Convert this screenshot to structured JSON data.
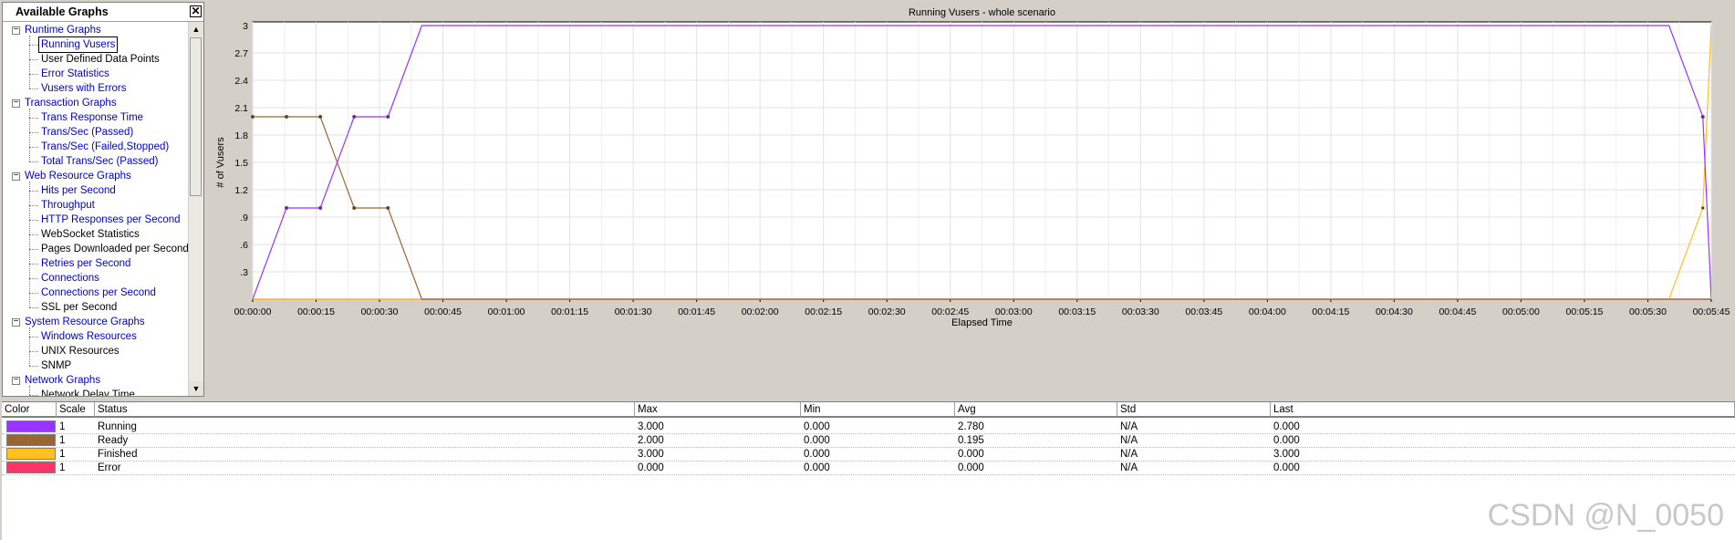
{
  "tree": {
    "title": "Available Graphs",
    "close_glyph": "✕",
    "items": [
      {
        "label": "Runtime Graphs",
        "type": "group"
      },
      {
        "label": "Running Vusers",
        "type": "leaf",
        "style": "blue",
        "selected": true
      },
      {
        "label": "User Defined Data Points",
        "type": "leaf",
        "style": "black"
      },
      {
        "label": "Error Statistics",
        "type": "leaf",
        "style": "blue"
      },
      {
        "label": "Vusers with Errors",
        "type": "leaf",
        "style": "blue"
      },
      {
        "label": "Transaction Graphs",
        "type": "group"
      },
      {
        "label": "Trans Response Time",
        "type": "leaf",
        "style": "blue"
      },
      {
        "label": "Trans/Sec (Passed)",
        "type": "leaf",
        "style": "blue"
      },
      {
        "label": "Trans/Sec (Failed,Stopped)",
        "type": "leaf",
        "style": "blue"
      },
      {
        "label": "Total Trans/Sec (Passed)",
        "type": "leaf",
        "style": "blue"
      },
      {
        "label": "Web Resource Graphs",
        "type": "group"
      },
      {
        "label": "Hits per Second",
        "type": "leaf",
        "style": "blue"
      },
      {
        "label": "Throughput",
        "type": "leaf",
        "style": "blue"
      },
      {
        "label": "HTTP Responses per Second",
        "type": "leaf",
        "style": "blue"
      },
      {
        "label": "WebSocket Statistics",
        "type": "leaf",
        "style": "black"
      },
      {
        "label": "Pages Downloaded per Second",
        "type": "leaf",
        "style": "black"
      },
      {
        "label": "Retries per Second",
        "type": "leaf",
        "style": "blue"
      },
      {
        "label": "Connections",
        "type": "leaf",
        "style": "blue"
      },
      {
        "label": "Connections per Second",
        "type": "leaf",
        "style": "blue"
      },
      {
        "label": "SSL per Second",
        "type": "leaf",
        "style": "black"
      },
      {
        "label": "System Resource Graphs",
        "type": "group"
      },
      {
        "label": "Windows Resources",
        "type": "leaf",
        "style": "blue"
      },
      {
        "label": "UNIX Resources",
        "type": "leaf",
        "style": "black"
      },
      {
        "label": "SNMP",
        "type": "leaf",
        "style": "black"
      },
      {
        "label": "Network Graphs",
        "type": "group"
      },
      {
        "label": "Network Delay Time",
        "type": "leaf",
        "style": "black"
      }
    ]
  },
  "chart_data": {
    "type": "line",
    "title": "Running Vusers - whole scenario",
    "xlabel": "Elapsed Time",
    "ylabel": "# of Vusers",
    "ylim": [
      0,
      3
    ],
    "yticks": [
      "3",
      "2.7",
      "2.4",
      "2.1",
      "1.8",
      "1.5",
      "1.2",
      ".9",
      ".6",
      ".3"
    ],
    "xticks": [
      "00:00:00",
      "00:00:15",
      "00:00:30",
      "00:00:45",
      "00:01:00",
      "00:01:15",
      "00:01:30",
      "00:01:45",
      "00:02:00",
      "00:02:15",
      "00:02:30",
      "00:02:45",
      "00:03:00",
      "00:03:15",
      "00:03:30",
      "00:03:45",
      "00:04:00",
      "00:04:15",
      "00:04:30",
      "00:04:45",
      "00:05:00",
      "00:05:15",
      "00:05:30",
      "00:05:45"
    ],
    "xlim_seconds": [
      0,
      345
    ],
    "grid": true,
    "series": [
      {
        "name": "Running",
        "color": "#9933ff",
        "points": [
          [
            0,
            0
          ],
          [
            8,
            1
          ],
          [
            16,
            1
          ],
          [
            24,
            2
          ],
          [
            32,
            2
          ],
          [
            40,
            3
          ],
          [
            335,
            3
          ],
          [
            343,
            2
          ],
          [
            345,
            0
          ]
        ]
      },
      {
        "name": "Ready",
        "color": "#996633",
        "points": [
          [
            0,
            2
          ],
          [
            8,
            2
          ],
          [
            16,
            2
          ],
          [
            24,
            1
          ],
          [
            32,
            1
          ],
          [
            40,
            0
          ],
          [
            345,
            0
          ]
        ]
      },
      {
        "name": "Finished",
        "color": "#ffc020",
        "points": [
          [
            0,
            0
          ],
          [
            335,
            0
          ],
          [
            343,
            1
          ],
          [
            345,
            3
          ]
        ]
      },
      {
        "name": "Error",
        "color": "#ff3366",
        "points": [
          [
            0,
            0
          ],
          [
            345,
            0
          ]
        ]
      }
    ]
  },
  "legend": {
    "headers": [
      "Color",
      "Scale",
      "Status",
      "Max",
      "Min",
      "Avg",
      "Std",
      "Last"
    ],
    "rows": [
      {
        "color": "#9933ff",
        "scale": "1",
        "status": "Running",
        "max": "3.000",
        "min": "0.000",
        "avg": "2.780",
        "std": "N/A",
        "last": "0.000"
      },
      {
        "color": "#996633",
        "scale": "1",
        "status": "Ready",
        "max": "2.000",
        "min": "0.000",
        "avg": "0.195",
        "std": "N/A",
        "last": "0.000"
      },
      {
        "color": "#ffc020",
        "scale": "1",
        "status": "Finished",
        "max": "3.000",
        "min": "0.000",
        "avg": "0.000",
        "std": "N/A",
        "last": "3.000"
      },
      {
        "color": "#ff3366",
        "scale": "1",
        "status": "Error",
        "max": "0.000",
        "min": "0.000",
        "avg": "0.000",
        "std": "N/A",
        "last": "0.000"
      }
    ]
  },
  "watermark": "CSDN @N_0050"
}
